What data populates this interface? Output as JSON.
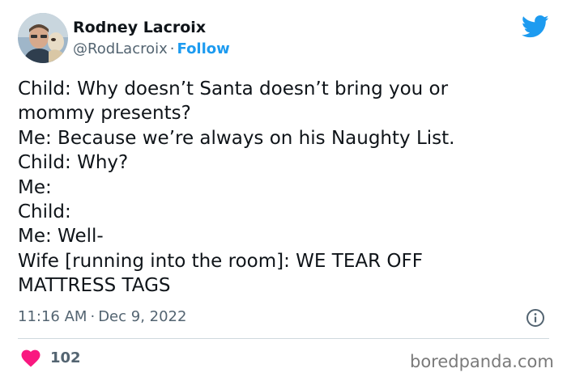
{
  "author": {
    "name": "Rodney Lacroix",
    "handle": "@RodLacroix",
    "separator": "·",
    "follow_label": "Follow"
  },
  "tweet": {
    "lines": [
      "Child: Why doesn’t Santa doesn’t bring you or",
      "mommy presents?",
      "Me: Because we’re always on his Naughty List.",
      "Child: Why?",
      "Me:",
      "Child:",
      "Me: Well-",
      "Wife [running into the room]: WE TEAR OFF",
      "MATTRESS TAGS"
    ]
  },
  "meta": {
    "time": "11:16 AM",
    "separator": "·",
    "date": "Dec 9, 2022"
  },
  "engagement": {
    "likes": "102"
  },
  "watermark": "boredpanda.com",
  "icons": {
    "brand": "twitter-bird-icon",
    "info": "info-icon",
    "like": "heart-icon"
  },
  "colors": {
    "brand_blue": "#1d9bf0",
    "heart_pink": "#f91880",
    "secondary_text": "#536471",
    "primary_text": "#0f1419"
  }
}
